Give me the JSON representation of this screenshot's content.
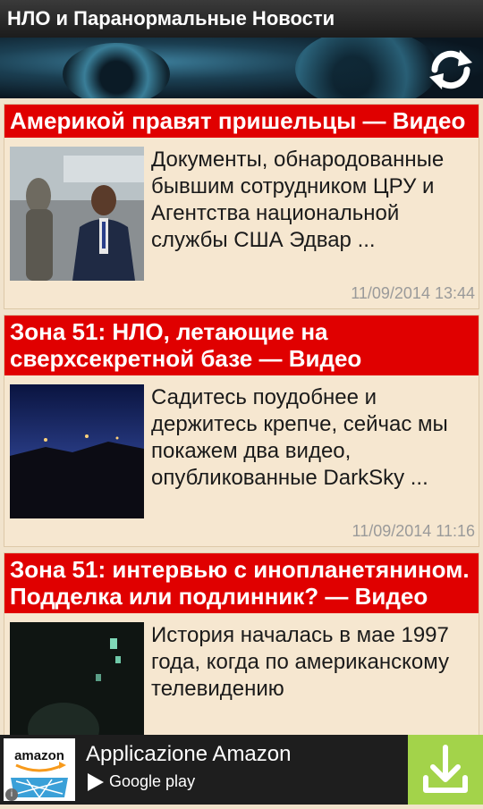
{
  "app": {
    "title": "НЛО и Паранормальные Новости"
  },
  "toolbar": {
    "refresh_icon": "refresh-icon"
  },
  "articles": [
    {
      "title": "Америкой правят пришельцы — Видео",
      "excerpt": "Документы, обнародованные бывшим сотрудником ЦРУ и Агентства национальной службы США Эдвар ...",
      "date": "11/09/2014 13:44"
    },
    {
      "title": "Зона 51: НЛО, летающие на сверхсекретной базе — Видео",
      "excerpt": "Садитесь поудобнее и держитесь крепче, сейчас мы покажем два видео, опубликованные DarkSky ...",
      "date": "11/09/2014 11:16"
    },
    {
      "title": "Зона 51: интервью с инопланетянином. Подделка или подлинник? — Видео",
      "excerpt": "История началась в мае 1997 года, когда по американскому телевидению",
      "date": ""
    }
  ],
  "ad": {
    "logo_text": "amazon",
    "title": "Applicazione Amazon",
    "store": "Google play",
    "download_icon": "download-icon",
    "info_icon": "info-icon"
  },
  "colors": {
    "title_red": "#e00000",
    "card_bg": "#f6e7d0",
    "page_bg": "#f1e3cc",
    "ad_green": "#a3d34a"
  }
}
